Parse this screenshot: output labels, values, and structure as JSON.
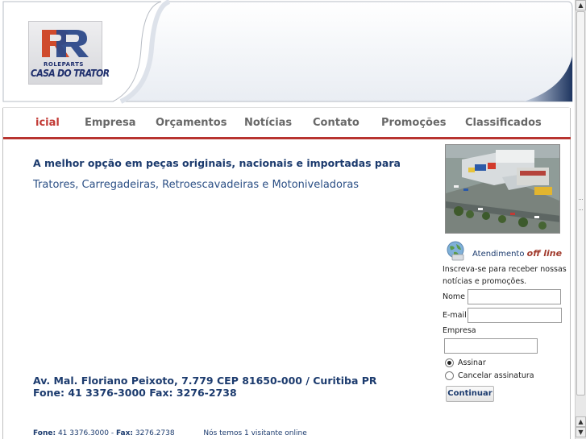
{
  "logo": {
    "brand_top": "ROLEPARTS",
    "brand_name": "CASA DO TRATOR"
  },
  "nav": {
    "items": [
      {
        "label": "icial"
      },
      {
        "label": "Empresa"
      },
      {
        "label": "Orçamentos"
      },
      {
        "label": "Notícias"
      },
      {
        "label": "Contato"
      },
      {
        "label": "Promoções"
      },
      {
        "label": "Classificados"
      }
    ]
  },
  "main": {
    "headline": "A melhor opção em peças originais, nacionais e importadas para",
    "subline": "Tratores, Carregadeiras, Retroescavadeiras e Motoniveladoras",
    "address_line1": "Av. Mal. Floriano Peixoto, 7.779 CEP 81650-000 / Curitiba PR",
    "address_line2": "Fone: 41 3376-3000 Fax: 3276-2738"
  },
  "footer": {
    "fone_label": "Fone:",
    "fone_value": "41 3376.3000",
    "sep": "-",
    "fax_label": "Fax:",
    "fax_value": "3276.2738",
    "visitors": "Nós temos 1 visitante online"
  },
  "sidebar": {
    "atendimento_label": "Atendimento",
    "atendimento_status": "off line",
    "newsletter_text_1": "Inscreva-se para receber nossas",
    "newsletter_text_2": "notícias e promoções.",
    "nome_label": "Nome",
    "nome_value": "",
    "email_label": "E-mail",
    "email_value": "",
    "empresa_label": "Empresa",
    "empresa_value": "",
    "radio_assinar": "Assinar",
    "radio_cancelar": "Cancelar assinatura",
    "radio_selected": "Assinar",
    "submit_label": "Continuar"
  },
  "colors": {
    "navy": "#1c3b6e",
    "accent_red": "#b83430",
    "nav_gray": "#686868"
  }
}
